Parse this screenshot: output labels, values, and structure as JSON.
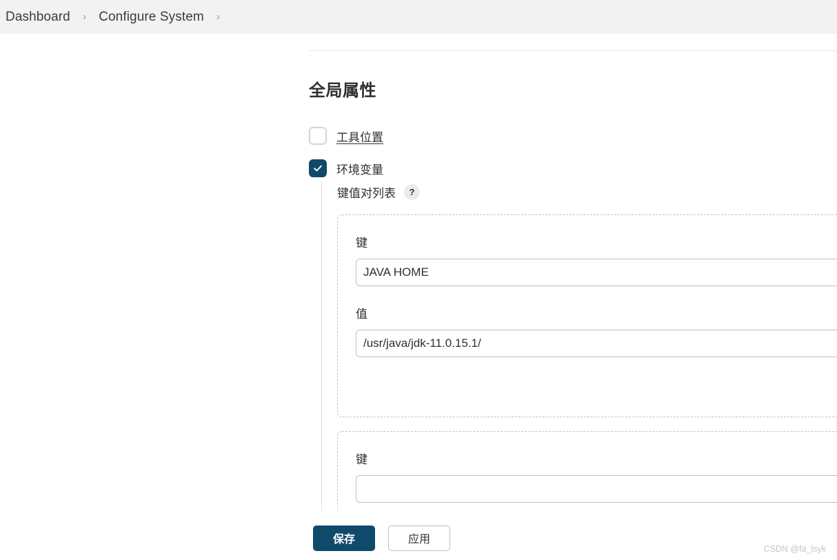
{
  "breadcrumb": {
    "items": [
      {
        "label": "Dashboard"
      },
      {
        "label": "Configure System"
      }
    ],
    "separator": "›"
  },
  "main": {
    "section_title": "全局属性",
    "options": [
      {
        "label": "工具位置",
        "checked": false
      },
      {
        "label": "环境变量",
        "checked": true
      }
    ],
    "kv_list": {
      "label": "键值对列表",
      "help_badge": "?",
      "entries": [
        {
          "key_label": "键",
          "key_value": "JAVA HOME",
          "value_label": "值",
          "value_value": "/usr/java/jdk-11.0.15.1/"
        },
        {
          "key_label": "键"
        }
      ]
    }
  },
  "footer": {
    "save_label": "保存",
    "apply_label": "应用"
  },
  "watermark": "CSDN @fa_lsyk",
  "colors": {
    "accent_navy": "#104a6b",
    "header_bg": "#f2f2f2",
    "input_border": "#b6c2c7",
    "dashed_border": "#b9c2cc"
  }
}
